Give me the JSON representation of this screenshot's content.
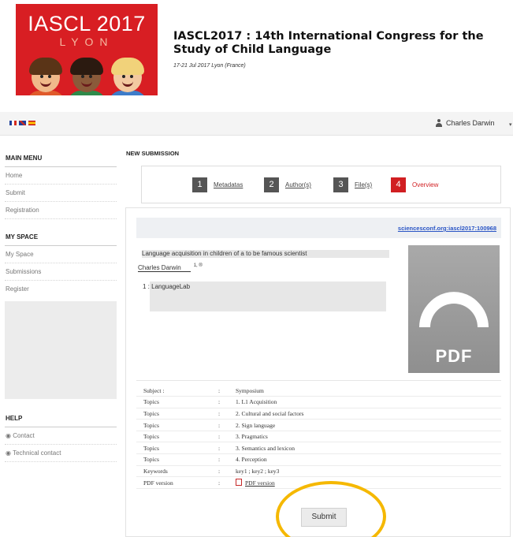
{
  "header": {
    "logo_title": "IASCL 2017",
    "logo_subtitle": "LYON",
    "conference_title": "IASCL2017 : 14th International Congress for the Study of Child Language",
    "conference_date": "17-21 Jul 2017 Lyon (France)"
  },
  "topbar": {
    "languages": [
      "fr",
      "en",
      "es"
    ],
    "user_name": "Charles Darwin"
  },
  "sidebar": {
    "main_menu": {
      "heading": "MAIN MENU",
      "items": [
        "Home",
        "Submit",
        "Registration"
      ]
    },
    "my_space": {
      "heading": "MY SPACE",
      "items": [
        "My Space",
        "Submissions",
        "Register"
      ]
    },
    "help": {
      "heading": "HELP",
      "items": [
        "Contact",
        "Technical contact"
      ]
    }
  },
  "main": {
    "section_label": "NEW SUBMISSION",
    "steps": [
      {
        "number": "1",
        "label": "Metadatas"
      },
      {
        "number": "2",
        "label": "Author(s)"
      },
      {
        "number": "3",
        "label": "File(s)"
      },
      {
        "number": "4",
        "label": "Overview"
      }
    ],
    "active_step": 4,
    "doi_link": "sciencesconf.org:iascl2017:100968",
    "paper_title": "Language acquisition in children of a to be famous scientist",
    "author_name": "Charles Darwin",
    "author_sup": "1, ®",
    "affiliation": "1 : LanguageLab",
    "pdf_thumb_label": "PDF",
    "metadata": [
      {
        "key": "Subject :",
        "value": "Symposium"
      },
      {
        "key": "Topics",
        "value": "1. L1 Acquisition"
      },
      {
        "key": "Topics",
        "value": "2. Cultural and social factors"
      },
      {
        "key": "Topics",
        "value": "2. Sign language"
      },
      {
        "key": "Topics",
        "value": "3. Pragmatics"
      },
      {
        "key": "Topics",
        "value": "3. Semantics and lexicon"
      },
      {
        "key": "Topics",
        "value": "4. Perception"
      },
      {
        "key": "Keywords",
        "value": "key1 ; key2 ; key3"
      },
      {
        "key": "PDF version",
        "value": "PDF version"
      }
    ],
    "separator": ":",
    "submit_label": "Submit"
  },
  "colors": {
    "brand_red": "#d81e23",
    "active_step": "#d11f22",
    "link_blue": "#2a55c5",
    "highlight_ring": "#f5b800"
  }
}
